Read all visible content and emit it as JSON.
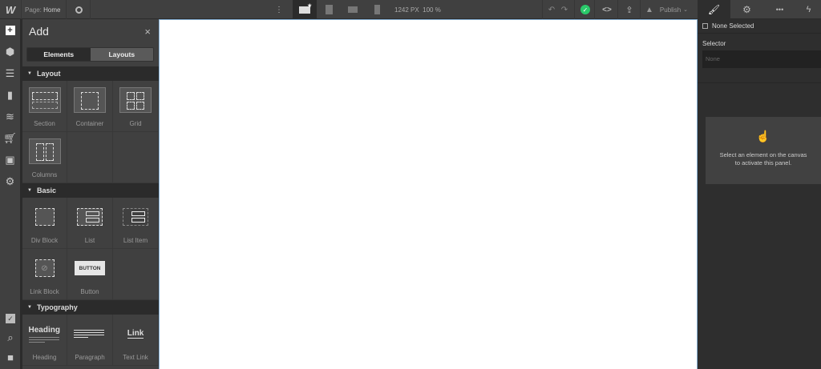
{
  "topbar": {
    "logo": "W",
    "page_label": "Page:",
    "page_name": "Home",
    "width": "1242 PX",
    "zoom": "100 %",
    "publish": "Publish"
  },
  "rail": {
    "icons": [
      "add-icon",
      "components-icon",
      "navigator-icon",
      "pages-icon",
      "cms-icon",
      "ecommerce-icon",
      "assets-icon",
      "settings-icon"
    ],
    "bottom": [
      "tasks-icon",
      "search-icon",
      "video-icon"
    ]
  },
  "panel": {
    "title": "Add",
    "tabs": {
      "elements": "Elements",
      "layouts": "Layouts"
    },
    "sections": [
      {
        "title": "Layout",
        "items": [
          "Section",
          "Container",
          "Grid",
          "Columns"
        ]
      },
      {
        "title": "Basic",
        "items": [
          "Div Block",
          "List",
          "List Item",
          "Link Block",
          "Button"
        ]
      },
      {
        "title": "Typography",
        "items": [
          "Heading",
          "Paragraph",
          "Text Link"
        ]
      }
    ],
    "button_preview": "BUTTON",
    "heading_preview": "Heading",
    "link_preview": "Link"
  },
  "right": {
    "none_selected": "None Selected",
    "selector_label": "Selector",
    "selector_placeholder": "None",
    "empty_msg_1": "Select an element on the canvas",
    "empty_msg_2": "to activate this panel."
  },
  "colors": {
    "accent_green": "#2ac96a",
    "canvas_border": "#8ab4d8"
  }
}
